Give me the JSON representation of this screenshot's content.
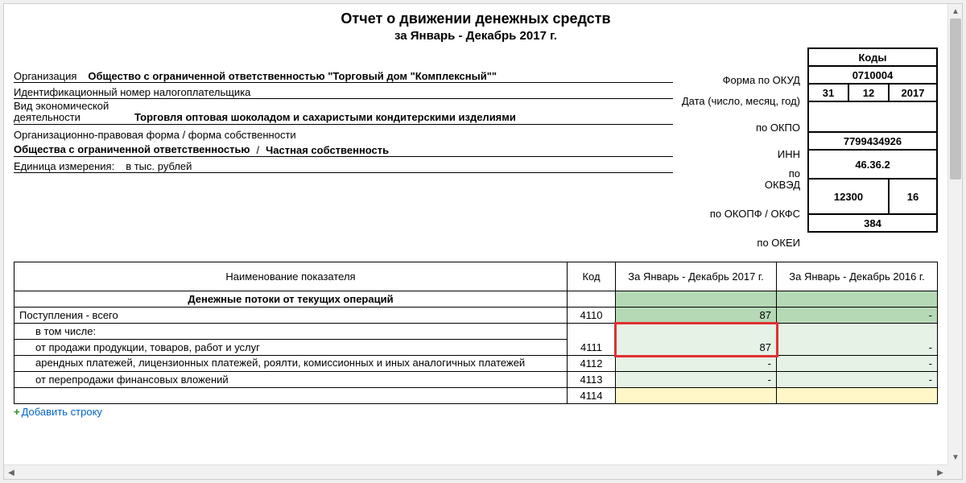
{
  "title": "Отчет о движении денежных средств",
  "subtitle": "за Январь - Декабрь 2017 г.",
  "codes": {
    "header": "Коды",
    "okud_label": "Форма по ОКУД",
    "okud": "0710004",
    "date_label": "Дата (число, месяц, год)",
    "date_d": "31",
    "date_m": "12",
    "date_y": "2017",
    "okpo_label": "по ОКПО",
    "okpo": "",
    "inn_label": "ИНН",
    "inn": "7799434926",
    "okved_label": "по ОКВЭД",
    "okved": "46.36.2",
    "okopf_label": "по ОКОПФ / ОКФС",
    "okopf": "12300",
    "okfs": "16",
    "okei_label": "по ОКЕИ",
    "okei": "384"
  },
  "meta": {
    "org_label": "Организация",
    "org_value": "Общество с ограниченной ответственностью \"Торговый дом \"Комплексный\"\"",
    "inn_row_label": "Идентификационный номер налогоплательщика",
    "activity_label": "Вид экономической деятельности",
    "activity_value": "Торговля оптовая шоколадом и сахаристыми кондитерскими изделиями",
    "form_label": "Организационно-правовая форма / форма собственности",
    "form_value_left": "Общества с ограниченной ответственностью",
    "form_sep": "/",
    "form_value_right": "Частная собственность",
    "unit_label": "Единица измерения:",
    "unit_value": "в тыс. рублей"
  },
  "table": {
    "col_name": "Наименование показателя",
    "col_code": "Код",
    "col_cur": "За Январь - Декабрь 2017 г.",
    "col_prev": "За Январь - Декабрь 2016 г.",
    "section": "Денежные потоки от текущих операций",
    "rows": [
      {
        "name": "Поступления - всего",
        "code": "4110",
        "cur": "87",
        "prev": "-"
      },
      {
        "name": "в том числе:",
        "code": "",
        "cur": "",
        "prev": ""
      },
      {
        "name": "от продажи продукции, товаров, работ и услуг",
        "code": "4111",
        "cur": "87",
        "prev": "-"
      },
      {
        "name": "арендных платежей, лицензионных платежей, роялти, комиссионных и иных аналогичных платежей",
        "code": "4112",
        "cur": "-",
        "prev": "-"
      },
      {
        "name": "от перепродажи финансовых вложений",
        "code": "4113",
        "cur": "-",
        "prev": "-"
      },
      {
        "name": "",
        "code": "4114",
        "cur": "",
        "prev": ""
      }
    ]
  },
  "add_row_label": "Добавить строку"
}
